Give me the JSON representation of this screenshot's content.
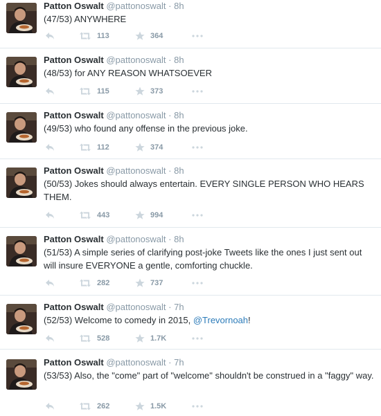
{
  "colors": {
    "accent": "#2b7bb9",
    "muted": "#8899a6",
    "icon": "#ccd6dd",
    "divider": "#e1e8ed"
  },
  "icons": {
    "reply": "reply-icon",
    "retweet": "retweet-icon",
    "favorite": "star-icon",
    "more": "more-dots-icon"
  },
  "tweets": [
    {
      "name": "Patton Oswalt",
      "handle": "@pattonoswalt",
      "sep": "·",
      "time": "8h",
      "text": "(47/53) ANYWHERE",
      "retweets": "113",
      "favorites": "364"
    },
    {
      "name": "Patton Oswalt",
      "handle": "@pattonoswalt",
      "sep": "·",
      "time": "8h",
      "text": "(48/53) for ANY REASON WHATSOEVER",
      "retweets": "115",
      "favorites": "373"
    },
    {
      "name": "Patton Oswalt",
      "handle": "@pattonoswalt",
      "sep": "·",
      "time": "8h",
      "text": "(49/53) who found any offense in the previous joke.",
      "retweets": "112",
      "favorites": "374"
    },
    {
      "name": "Patton Oswalt",
      "handle": "@pattonoswalt",
      "sep": "·",
      "time": "8h",
      "text": "(50/53) Jokes should always entertain. EVERY SINGLE PERSON WHO HEARS THEM.",
      "retweets": "443",
      "favorites": "994"
    },
    {
      "name": "Patton Oswalt",
      "handle": "@pattonoswalt",
      "sep": "·",
      "time": "8h",
      "text": "(51/53) A simple series of clarifying post-joke Tweets like the ones I just sent out will insure EVERYONE a gentle, comforting chuckle.",
      "retweets": "282",
      "favorites": "737"
    },
    {
      "name": "Patton Oswalt",
      "handle": "@pattonoswalt",
      "sep": "·",
      "time": "7h",
      "text": "(52/53) Welcome to comedy in 2015, ",
      "mention": "@Trevornoah",
      "text_end": "!",
      "retweets": "528",
      "favorites": "1.7K"
    },
    {
      "name": "Patton Oswalt",
      "handle": "@pattonoswalt",
      "sep": "·",
      "time": "7h",
      "text": "(53/53) Also, the \"come\" part of \"welcome\" shouldn't be construed in a \"faggy\" way.",
      "retweets": "262",
      "favorites": "1.5K"
    }
  ]
}
